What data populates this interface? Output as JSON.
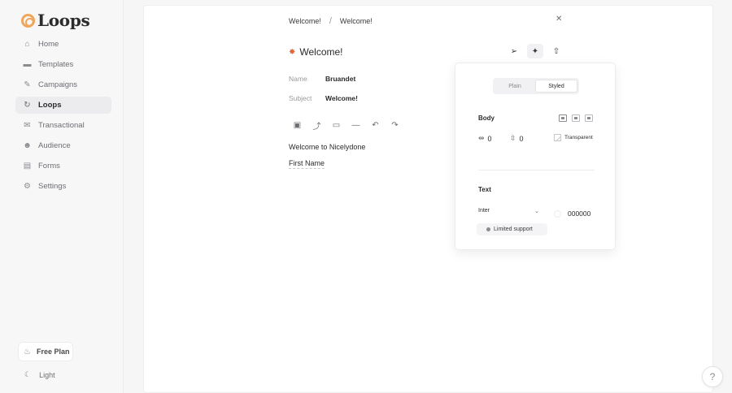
{
  "brand": {
    "name": "Loops",
    "accent": "#f0a65a"
  },
  "sidebar": {
    "items": [
      {
        "label": "Home",
        "icon": "home-icon",
        "active": false
      },
      {
        "label": "Templates",
        "icon": "folder-icon",
        "active": false
      },
      {
        "label": "Campaigns",
        "icon": "pencil-icon",
        "active": false
      },
      {
        "label": "Loops",
        "icon": "refresh-icon",
        "active": true
      },
      {
        "label": "Transactional",
        "icon": "mail-icon",
        "active": false
      },
      {
        "label": "Audience",
        "icon": "users-icon",
        "active": false
      },
      {
        "label": "Forms",
        "icon": "form-icon",
        "active": false
      },
      {
        "label": "Settings",
        "icon": "gear-icon",
        "active": false
      }
    ],
    "plan_label": "Free Plan",
    "theme_label": "Light"
  },
  "breadcrumb": {
    "first": "Welcome!",
    "separator": "/",
    "second": "Welcome!"
  },
  "email": {
    "title": "Welcome!",
    "name_label": "Name",
    "name_value": "Bruandet",
    "subject_label": "Subject",
    "subject_value": "Welcome!",
    "body_line1": "Welcome to Nicelydone",
    "body_line2": "First Name"
  },
  "style_panel": {
    "tabs": [
      "Plain",
      "Styled"
    ],
    "active_tab": "Styled",
    "body_label": "Body",
    "padding_x": "0",
    "padding_y": "0",
    "background": "Transparent",
    "text_label": "Text",
    "font": "Inter",
    "color": "000000",
    "limited_support": "Limited support"
  }
}
